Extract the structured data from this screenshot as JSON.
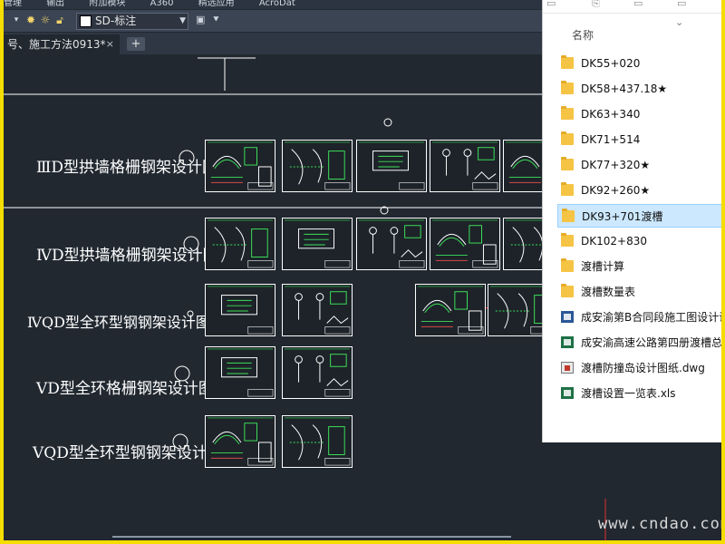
{
  "menubar": {
    "items": [
      "管理",
      "输出",
      "附加模块",
      "A360",
      "精选应用",
      "AcroDat"
    ]
  },
  "toolbar": {
    "layer_name": "SD-标注"
  },
  "tabs": {
    "doc_label": "号、施工方法0913*",
    "close": "×",
    "add": "+"
  },
  "drawing": {
    "rows": [
      {
        "label": "ⅢD型拱墙格栅钢架设计图"
      },
      {
        "label": "ⅣD型拱墙格栅钢架设计图"
      },
      {
        "label": "ⅣQD型全环型钢钢架设计图"
      },
      {
        "label": "ⅤD型全环格栅钢架设计图"
      },
      {
        "label": "ⅤQD型全环型钢钢架设计图"
      }
    ]
  },
  "explorer": {
    "column_header": "名称",
    "items": [
      {
        "name": "DK55+020",
        "type": "folder",
        "selected": false
      },
      {
        "name": "DK58+437.18★",
        "type": "folder",
        "selected": false
      },
      {
        "name": "DK63+340",
        "type": "folder",
        "selected": false
      },
      {
        "name": "DK71+514",
        "type": "folder",
        "selected": false
      },
      {
        "name": "DK77+320★",
        "type": "folder",
        "selected": false
      },
      {
        "name": "DK92+260★",
        "type": "folder",
        "selected": false
      },
      {
        "name": "DK93+701渡槽",
        "type": "folder",
        "selected": true
      },
      {
        "name": "DK102+830",
        "type": "folder",
        "selected": false
      },
      {
        "name": "渡槽计算",
        "type": "folder",
        "selected": false
      },
      {
        "name": "渡槽数量表",
        "type": "folder",
        "selected": false
      },
      {
        "name": "成安渝第B合同段施工图设计说",
        "type": "word",
        "selected": false
      },
      {
        "name": "成安渝高速公路第四册渡槽总目",
        "type": "excel",
        "selected": false
      },
      {
        "name": "渡槽防撞岛设计图纸.dwg",
        "type": "dwg",
        "selected": false
      },
      {
        "name": "渡槽设置一览表.xls",
        "type": "excel",
        "selected": false
      }
    ]
  },
  "watermark": "www.cndao.com",
  "colors": {
    "canvas": "#212830",
    "frame": "#f5dd00",
    "selection": "#cce8ff"
  }
}
